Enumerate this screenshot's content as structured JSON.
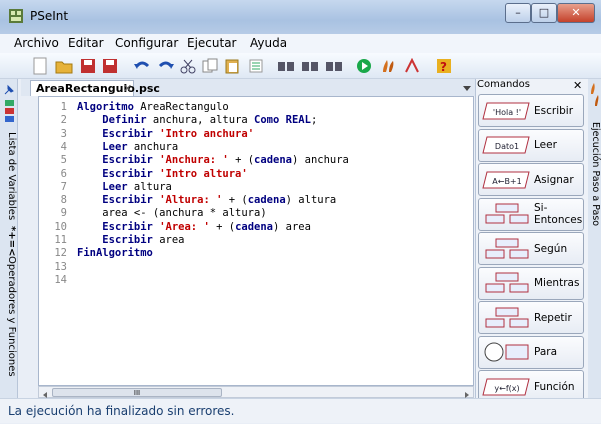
{
  "window": {
    "title": "PSeInt",
    "minimize": "–",
    "maximize": "□",
    "close": "✕"
  },
  "menu": [
    "Archivo",
    "Editar",
    "Configurar",
    "Ejecutar",
    "Ayuda"
  ],
  "side_left": {
    "variables": "Lista de Variables",
    "operators": "Operadores y Funciones",
    "operators_symbols": "*+=<"
  },
  "tab": {
    "label": "AreaRectangulo.psc",
    "close": "✕"
  },
  "code_lines": [
    {
      "n": "1",
      "parts": [
        [
          "kw",
          "Algoritmo"
        ],
        [
          "id",
          " AreaRectangulo"
        ]
      ]
    },
    {
      "n": "2",
      "parts": [
        [
          "id",
          "    "
        ],
        [
          "kw",
          "Definir"
        ],
        [
          "id",
          " anchura, altura "
        ],
        [
          "kw",
          "Como REAL"
        ],
        [
          "id",
          ";"
        ]
      ]
    },
    {
      "n": "3",
      "parts": [
        [
          "id",
          "    "
        ],
        [
          "kw",
          "Escribir"
        ],
        [
          "id",
          " "
        ],
        [
          "str",
          "'Intro anchura'"
        ]
      ]
    },
    {
      "n": "4",
      "parts": [
        [
          "id",
          "    "
        ],
        [
          "kw",
          "Leer"
        ],
        [
          "id",
          " anchura"
        ]
      ]
    },
    {
      "n": "5",
      "parts": [
        [
          "id",
          "    "
        ],
        [
          "kw",
          "Escribir"
        ],
        [
          "id",
          " "
        ],
        [
          "str",
          "'Anchura: '"
        ],
        [
          "id",
          " + ("
        ],
        [
          "kw",
          "cadena"
        ],
        [
          "id",
          ") anchura"
        ]
      ]
    },
    {
      "n": "6",
      "parts": [
        [
          "id",
          "    "
        ],
        [
          "kw",
          "Escribir"
        ],
        [
          "id",
          " "
        ],
        [
          "str",
          "'Intro altura'"
        ]
      ]
    },
    {
      "n": "7",
      "parts": [
        [
          "id",
          "    "
        ],
        [
          "kw",
          "Leer"
        ],
        [
          "id",
          " altura"
        ]
      ]
    },
    {
      "n": "8",
      "parts": [
        [
          "id",
          "    "
        ],
        [
          "kw",
          "Escribir"
        ],
        [
          "id",
          " "
        ],
        [
          "str",
          "'Altura: '"
        ],
        [
          "id",
          " + ("
        ],
        [
          "kw",
          "cadena"
        ],
        [
          "id",
          ") altura"
        ]
      ]
    },
    {
      "n": "9",
      "parts": [
        [
          "id",
          "    area <- (anchura * altura)"
        ]
      ]
    },
    {
      "n": "10",
      "parts": [
        [
          "id",
          "    "
        ],
        [
          "kw",
          "Escribir"
        ],
        [
          "id",
          " "
        ],
        [
          "str",
          "'Area: '"
        ],
        [
          "id",
          " + ("
        ],
        [
          "kw",
          "cadena"
        ],
        [
          "id",
          ") area"
        ]
      ]
    },
    {
      "n": "11",
      "parts": [
        [
          "id",
          "    "
        ],
        [
          "kw",
          "Escribir"
        ],
        [
          "id",
          " area"
        ]
      ]
    },
    {
      "n": "12",
      "parts": [
        [
          "kw",
          "FinAlgoritmo"
        ]
      ]
    },
    {
      "n": "13",
      "parts": []
    },
    {
      "n": "14",
      "parts": []
    }
  ],
  "commands": {
    "header": "Comandos",
    "close": "✕",
    "items": [
      {
        "label": "Escribir",
        "icon": "escribir-icon",
        "glyph": "'Hola !'"
      },
      {
        "label": "Leer",
        "icon": "leer-icon",
        "glyph": "Dato1"
      },
      {
        "label": "Asignar",
        "icon": "asignar-icon",
        "glyph": "A←B+1"
      },
      {
        "label": "Si-Entonces",
        "icon": "si-entonces-icon",
        "glyph": ""
      },
      {
        "label": "Según",
        "icon": "segun-icon",
        "glyph": ""
      },
      {
        "label": "Mientras",
        "icon": "mientras-icon",
        "glyph": ""
      },
      {
        "label": "Repetir",
        "icon": "repetir-icon",
        "glyph": ""
      },
      {
        "label": "Para",
        "icon": "para-icon",
        "glyph": ""
      },
      {
        "label": "Función",
        "icon": "funcion-icon",
        "glyph": "y←f(x)"
      }
    ]
  },
  "side_right": {
    "label": "Ejecución Paso a Paso"
  },
  "scrollbar": {
    "thumb": "III"
  },
  "status": "La ejecución ha finalizado sin errores.",
  "colors": {
    "keyword": "#000080",
    "string": "#c00000",
    "status_text": "#1a3f70"
  }
}
